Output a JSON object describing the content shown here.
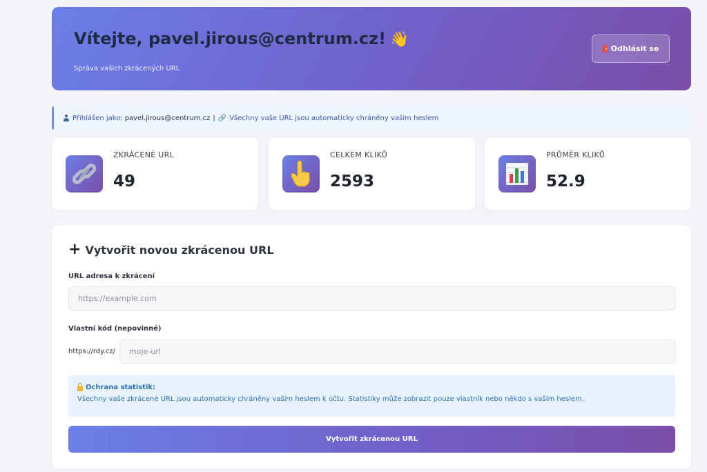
{
  "header": {
    "title": "Vítejte, pavel.jirous@centrum.cz!",
    "wave_emoji": "👋",
    "subtitle": "Správa vašich zkrácených URL",
    "logout_label": "Odhlásit se",
    "gradient": [
      "#6b7fe6",
      "#7a4ea8"
    ]
  },
  "infobar": {
    "logged_label": "Přihlášen jako:",
    "logged_value": "pavel.jirous@centrum.cz",
    "separator": "|",
    "note": "Všechny vaše URL jsou automaticky chráněny vaším heslem"
  },
  "stats": [
    {
      "label": "ZKRÁCENÉ URL",
      "value": "49",
      "icon": "link-icon"
    },
    {
      "label": "CELKEM KLIKŮ",
      "value": "2593",
      "icon": "pointing-hand-icon"
    },
    {
      "label": "PRŮMĚR KLIKŮ",
      "value": "52.9",
      "icon": "bar-chart-icon"
    }
  ],
  "form": {
    "title": "Vytvořit novou zkrácenou URL",
    "url_label": "URL adresa k zkrácení",
    "url_placeholder": "https://example.com",
    "url_value": "",
    "code_label": "Vlastní kód (nepovinné)",
    "code_prefix": "https://rdy.cz/",
    "code_placeholder": "moje-url",
    "code_value": "",
    "notice_title": "Ochrana statistik:",
    "notice_text": "Všechny vaše zkrácené URL jsou automaticky chráněny vaším heslem k účtu. Statistiky může zobrazit pouze vlastník nebo někdo s vaším heslem.",
    "submit_label": "Vytvořit zkrácenou URL"
  }
}
